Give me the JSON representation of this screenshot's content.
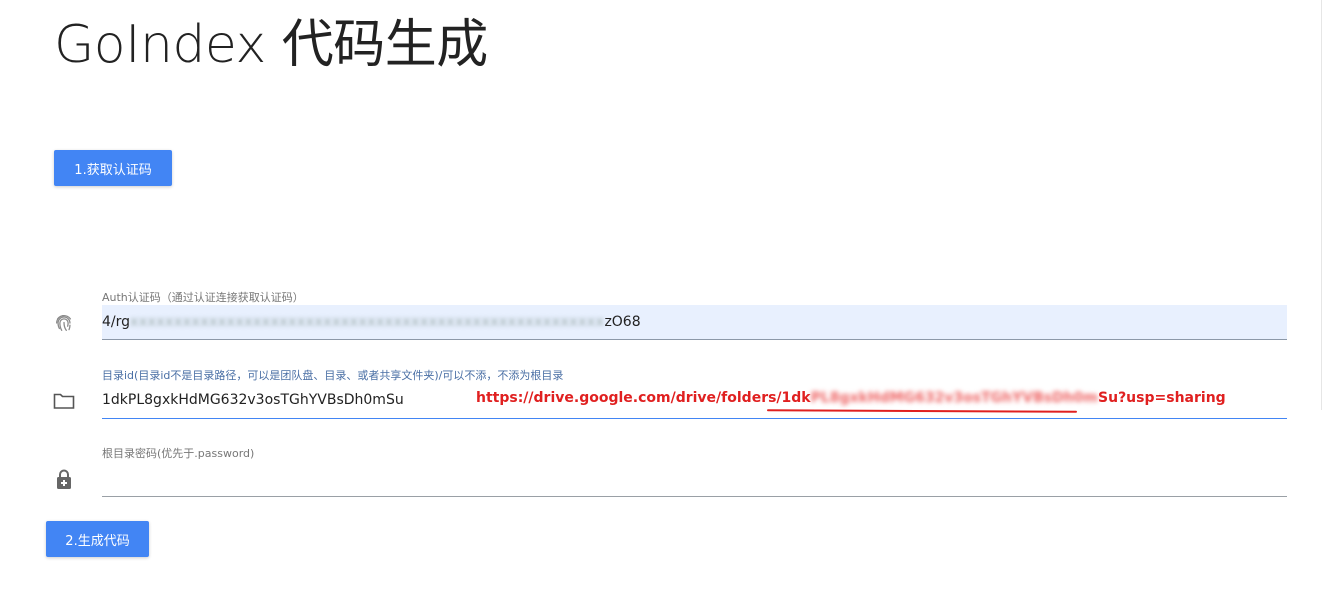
{
  "page": {
    "title": "GoIndex 代码生成"
  },
  "buttons": {
    "get_auth_code": "1.获取认证码",
    "generate_code": "2.生成代码"
  },
  "auth_field": {
    "label": "Auth认证码（通过认证连接获取认证码）",
    "value_prefix": "4/rg",
    "value_redacted": "xxxxxxxxxxxxxxxxxxxxxxxxxxxxxxxxxxxxxxxxxxxxxxxxxxxxxx",
    "value_suffix": "zO68",
    "icon": "fingerprint-icon"
  },
  "dir_field": {
    "label": "目录id(目录id不是目录路径，可以是团队盘、目录、或者共享文件夹)/可以不添，不添为根目录",
    "value": "1dkPL8gxkHdMG632v3osTGhYVBsDh0mSu",
    "icon": "folder-icon",
    "annotation_prefix": "https://drive.google.com/drive/folders/1dk",
    "annotation_redacted": "PL8gxkHdMG632v3osTGhYVBsDh0m",
    "annotation_suffix": "Su?usp=sharing",
    "annotation_color": "#e02020"
  },
  "password_field": {
    "label": "根目录密码(优先于.password)",
    "value": "",
    "icon": "lock-icon"
  },
  "colors": {
    "primary": "#4285f4",
    "autofill_bg": "#e8f0fe"
  }
}
